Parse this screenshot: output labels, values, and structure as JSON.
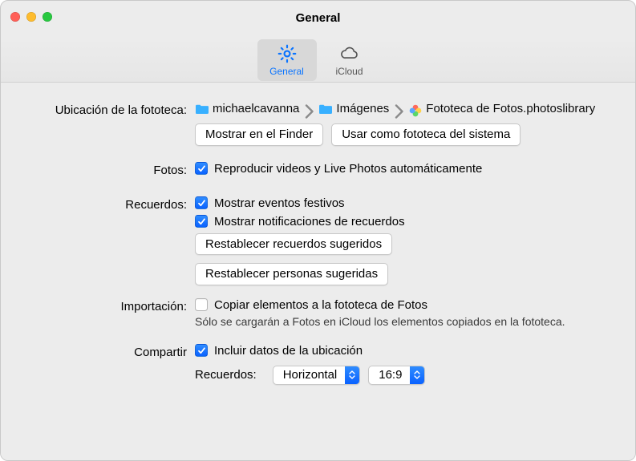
{
  "window": {
    "title": "General"
  },
  "tabs": {
    "general": "General",
    "icloud": "iCloud"
  },
  "labels": {
    "library_location": "Ubicación de la fototeca:",
    "photos": "Fotos:",
    "memories": "Recuerdos:",
    "import": "Importación:",
    "share": "Compartir",
    "memories_small": "Recuerdos:"
  },
  "path": {
    "seg1": "michaelcavanna",
    "seg2": "Imágenes",
    "seg3": "Fototeca de Fotos.photoslibrary"
  },
  "buttons": {
    "show_in_finder": "Mostrar en el Finder",
    "use_as_system": "Usar como fototeca del sistema",
    "reset_memories": "Restablecer recuerdos sugeridos",
    "reset_people": "Restablecer personas sugeridas"
  },
  "checks": {
    "autoplay": "Reproducir videos y Live Photos automáticamente",
    "show_holidays": "Mostrar eventos festivos",
    "show_notifications": "Mostrar notificaciones de recuerdos",
    "copy_to_library": "Copiar elementos a la fototeca de Fotos",
    "include_location": "Incluir datos de la ubicación"
  },
  "hint": {
    "import": "Sólo se cargarán a Fotos en iCloud los elementos copiados en la fototeca."
  },
  "popups": {
    "orientation": "Horizontal",
    "aspect": "16:9"
  }
}
